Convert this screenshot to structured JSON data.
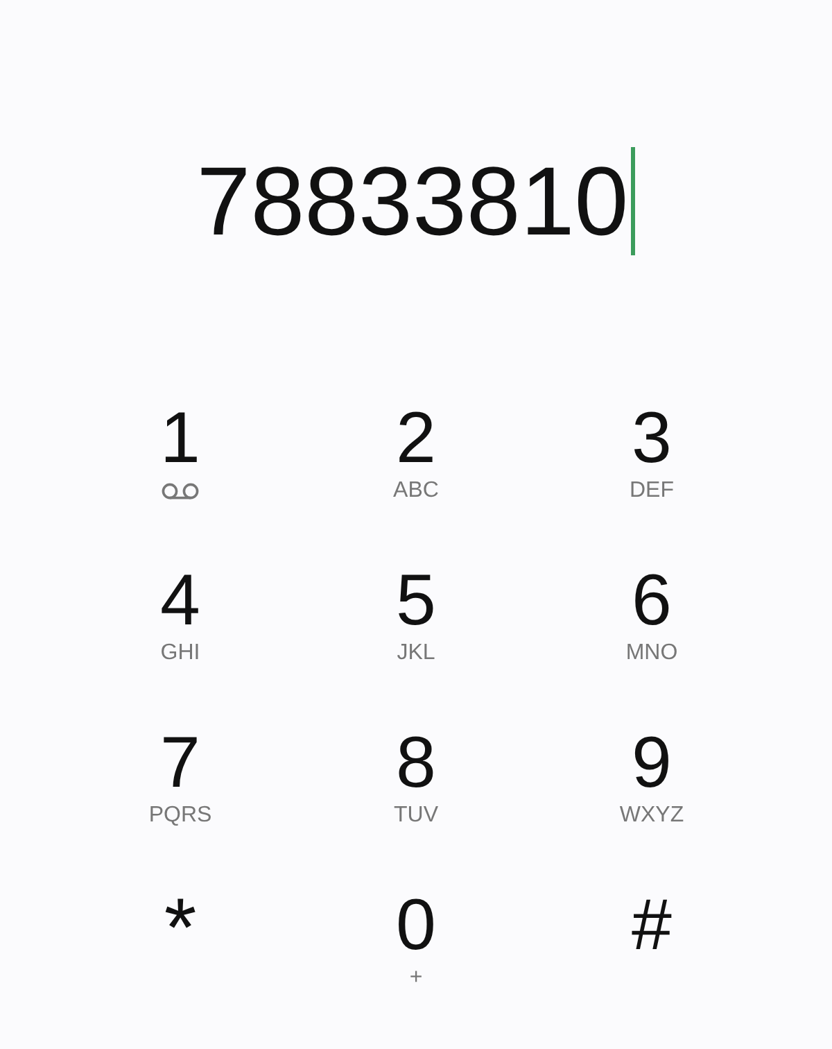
{
  "dialer": {
    "number": "78833810",
    "cursor": true
  },
  "keys": [
    {
      "digit": "1",
      "kind": "voicemail"
    },
    {
      "digit": "2",
      "kind": "letters",
      "letters": "ABC"
    },
    {
      "digit": "3",
      "kind": "letters",
      "letters": "DEF"
    },
    {
      "digit": "4",
      "kind": "letters",
      "letters": "GHI"
    },
    {
      "digit": "5",
      "kind": "letters",
      "letters": "JKL"
    },
    {
      "digit": "6",
      "kind": "letters",
      "letters": "MNO"
    },
    {
      "digit": "7",
      "kind": "letters",
      "letters": "PQRS"
    },
    {
      "digit": "8",
      "kind": "letters",
      "letters": "TUV"
    },
    {
      "digit": "9",
      "kind": "letters",
      "letters": "WXYZ"
    },
    {
      "digit": "*",
      "kind": "star"
    },
    {
      "digit": "0",
      "kind": "letters",
      "letters": "+"
    },
    {
      "digit": "#",
      "kind": "plain"
    }
  ]
}
